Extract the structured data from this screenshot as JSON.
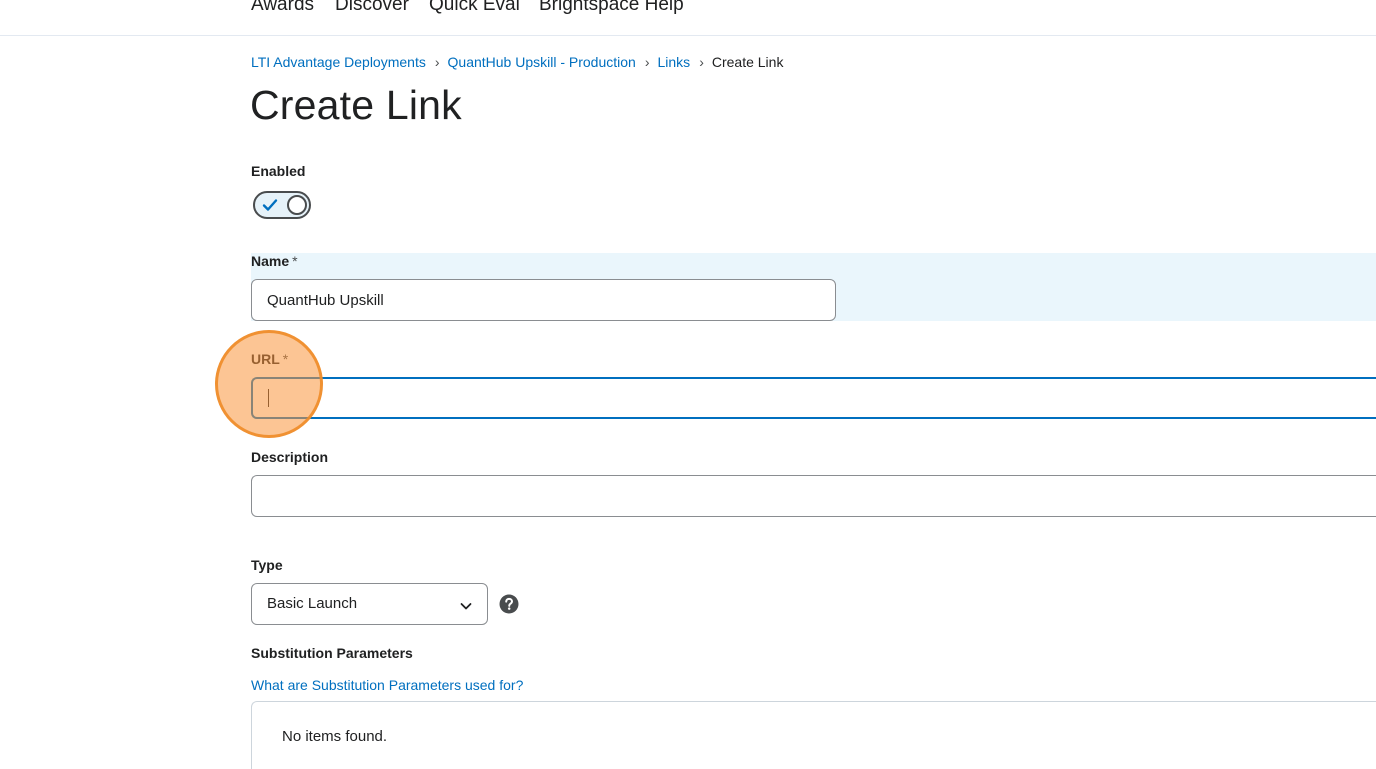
{
  "nav": {
    "items": [
      "Awards",
      "Discover",
      "Quick Eval",
      "Brightspace Help"
    ]
  },
  "breadcrumb": {
    "items": [
      "LTI Advantage Deployments",
      "QuantHub Upskill - Production",
      "Links"
    ],
    "current": "Create Link",
    "separator": "›"
  },
  "page": {
    "title": "Create Link"
  },
  "form": {
    "enabled": {
      "label": "Enabled",
      "value": true
    },
    "name": {
      "label": "Name",
      "required_marker": "*",
      "value": "QuantHub Upskill"
    },
    "url": {
      "label": "URL",
      "required_marker": "*",
      "value": ""
    },
    "description": {
      "label": "Description",
      "value": ""
    },
    "type": {
      "label": "Type",
      "selected": "Basic Launch",
      "help_icon": "question-circle-icon"
    },
    "substitution": {
      "label": "Substitution Parameters",
      "help_link": "What are Substitution Parameters used for?",
      "empty_text": "No items found."
    }
  },
  "colors": {
    "link": "#006fbf",
    "focus_border": "#006fbf",
    "highlight_band": "#eaf6fc",
    "click_marker": "#f5a05a"
  }
}
